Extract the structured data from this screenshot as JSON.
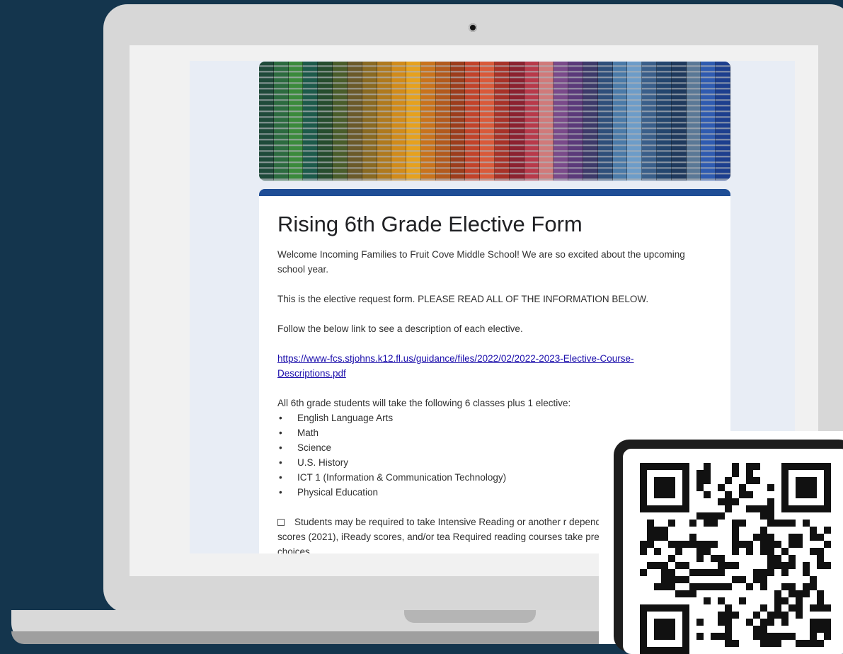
{
  "form": {
    "title": "Rising 6th Grade Elective Form",
    "welcome": "Welcome Incoming Families to Fruit Cove Middle School! We are so excited about the upcoming school year.",
    "instructions": "This is the elective request form. PLEASE READ ALL OF THE INFORMATION BELOW.",
    "follow_link_text": "Follow the below link to see a description of each elective.",
    "link": "https://www-fcs.stjohns.k12.fl.us/guidance/files/2022/02/2022-2023-Elective-Course-Descriptions.pdf",
    "classes_intro": "All 6th grade students will take the following 6 classes plus 1 elective:",
    "classes": [
      "English Language Arts",
      "Math",
      "Science",
      "U.S. History",
      "ICT 1 (Information & Communication Technology)",
      "Physical Education"
    ],
    "note": "Students may be required to take Intensive Reading or another r depending on FSA Reading scores (2021), iReady scores, and/or tea Required reading courses take precedence over elective choices."
  },
  "colors": {
    "background": "#14354d",
    "form_accent": "#1f4e96",
    "link": "#1a0dab",
    "banner_strands": [
      "#1f4a3a",
      "#2c6b3f",
      "#3b8a3c",
      "#1d5a4a",
      "#264d2e",
      "#4a5d2a",
      "#6b5a2a",
      "#8a6a22",
      "#b07a1e",
      "#d18b1a",
      "#e6a11e",
      "#c9731c",
      "#b35a1d",
      "#9d3d1c",
      "#c2432a",
      "#d95a3a",
      "#a83228",
      "#8c2230",
      "#b83a4a",
      "#d07a7a",
      "#7a4a8a",
      "#5b3a7a",
      "#3d3a6a",
      "#2f4f7a",
      "#4a7aa8",
      "#6d9cc8",
      "#3a5f8a",
      "#24466e",
      "#1f3a5e",
      "#5a7896",
      "#2f5bb0",
      "#1d3f8e"
    ],
    "qr_dark": "#111111"
  },
  "icons": {
    "camera": "camera-icon",
    "qr": "qr-code-icon",
    "note_bullet": "square-bullet-icon"
  }
}
